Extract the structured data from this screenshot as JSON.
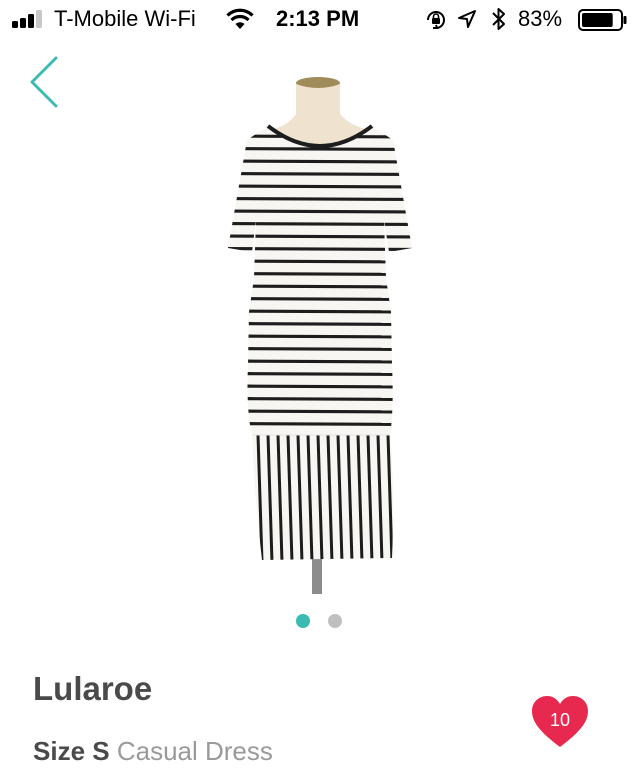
{
  "status_bar": {
    "carrier": "T-Mobile Wi-Fi",
    "time": "2:13 PM",
    "battery_percent": "83%",
    "signal_bars_filled": 3,
    "signal_bars_total": 4,
    "battery_level": 0.83,
    "icons": [
      "signal-icon",
      "wifi-icon",
      "rotation-lock-icon",
      "location-icon",
      "bluetooth-icon",
      "battery-icon"
    ]
  },
  "nav": {
    "back_icon": "chevron-left-icon",
    "accent_color": "#3bbcb2"
  },
  "gallery": {
    "image_count": 2,
    "active_index": 0
  },
  "product": {
    "brand": "Lularoe",
    "size_label": "Size",
    "size_value": "S",
    "category": "Casual Dress",
    "favorites_count": "10",
    "favorite_color": "#e8294f"
  }
}
